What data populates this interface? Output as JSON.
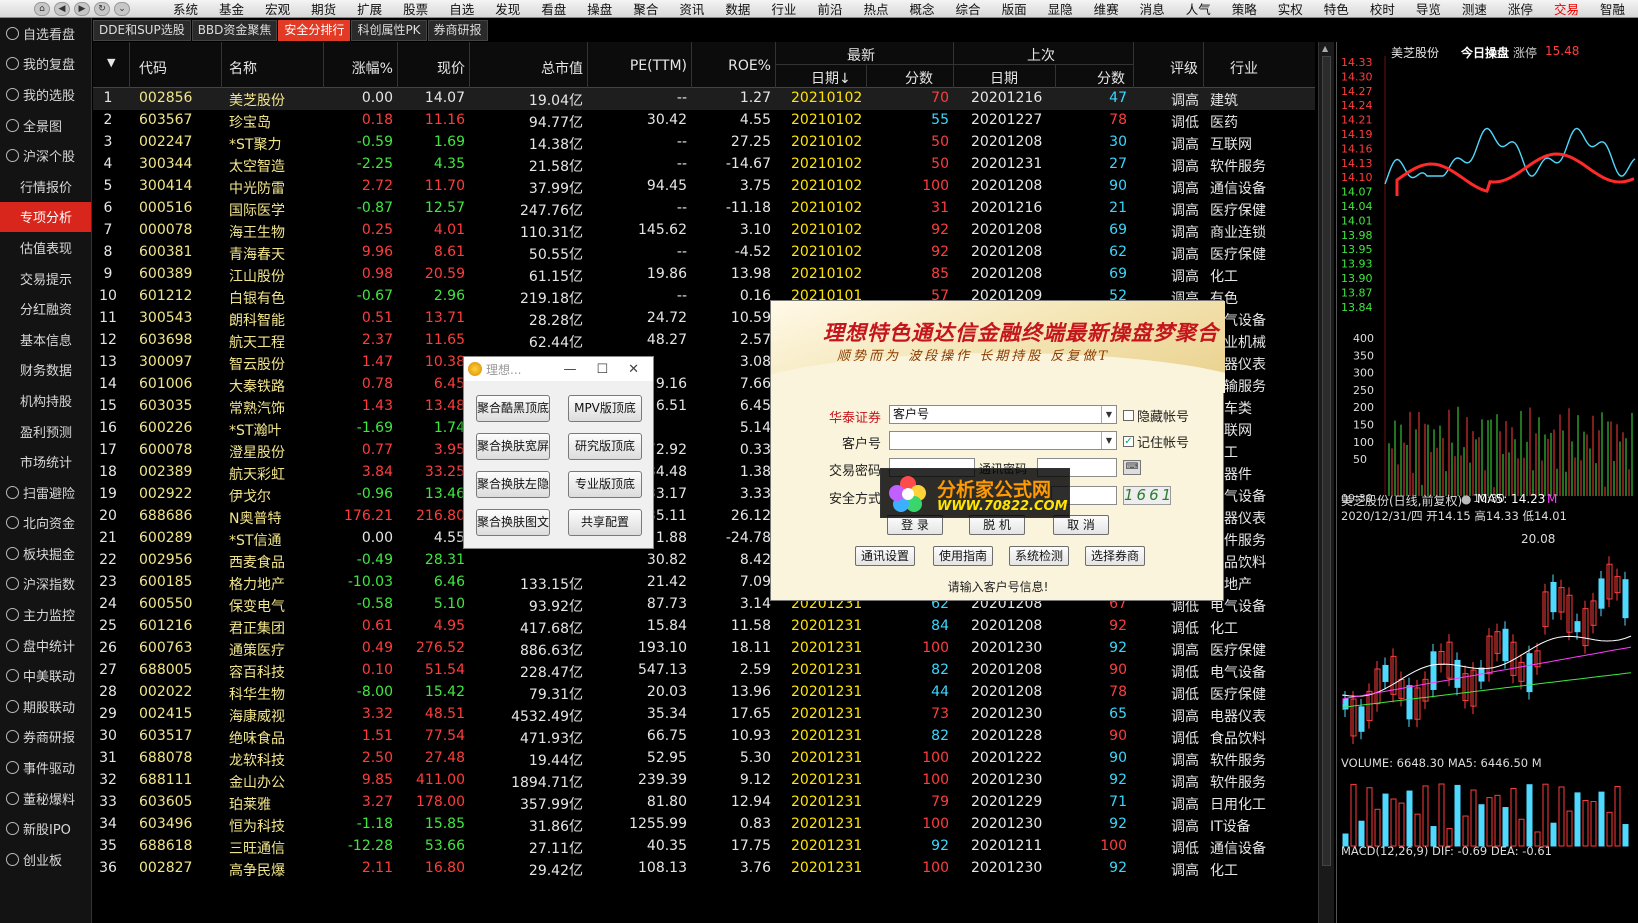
{
  "menu": [
    "系统",
    "基金",
    "宏观",
    "期货",
    "扩展",
    "股票",
    "自选",
    "发现",
    "看盘",
    "操盘",
    "聚合",
    "资讯",
    "数据",
    "行业",
    "前沿",
    "热点",
    "概念",
    "综合",
    "版面",
    "显隐",
    "维赛",
    "消息",
    "人气",
    "策略",
    "实权",
    "特色",
    "校时",
    "导览",
    "测速",
    "涨停",
    "交易",
    "智融"
  ],
  "menu_red_index": 30,
  "sidebar": [
    {
      "label": "自选看盘",
      "icon": "circle-icon"
    },
    {
      "label": "我的复盘",
      "icon": "heart-icon"
    },
    {
      "label": "我的选股",
      "icon": "circle-icon"
    },
    {
      "label": "全景图",
      "icon": "panorama-icon"
    },
    {
      "label": "沪深个股",
      "icon": "circle-icon"
    },
    {
      "label": "行情报价",
      "sub": true
    },
    {
      "label": "专项分析",
      "sub": true,
      "active": true
    },
    {
      "label": "估值表现",
      "sub": true
    },
    {
      "label": "交易提示",
      "sub": true
    },
    {
      "label": "分红融资",
      "sub": true
    },
    {
      "label": "基本信息",
      "sub": true
    },
    {
      "label": "财务数据",
      "sub": true
    },
    {
      "label": "机构持股",
      "sub": true
    },
    {
      "label": "盈利预测",
      "sub": true
    },
    {
      "label": "市场统计",
      "sub": true
    },
    {
      "label": "扫雷避险",
      "icon": "circle-icon"
    },
    {
      "label": "北向资金",
      "icon": "circle-icon"
    },
    {
      "label": "板块掘金",
      "icon": "star-icon"
    },
    {
      "label": "沪深指数",
      "icon": "circle-icon"
    },
    {
      "label": "主力监控",
      "icon": "circle-icon"
    },
    {
      "label": "盘中统计",
      "icon": "circle-icon"
    },
    {
      "label": "中美联动",
      "icon": "circle-icon"
    },
    {
      "label": "期股联动",
      "icon": "circle-icon"
    },
    {
      "label": "券商研报",
      "icon": "circle-icon"
    },
    {
      "label": "事件驱动",
      "icon": "circle-icon"
    },
    {
      "label": "董秘爆料",
      "icon": "circle-icon"
    },
    {
      "label": "新股IPO",
      "icon": "circle-icon"
    },
    {
      "label": "创业板",
      "icon": "circle-icon"
    }
  ],
  "subtabs": [
    "DDE和SUP选股",
    "BBD资金聚焦",
    "安全分排行",
    "科创属性PK",
    "券商研报"
  ],
  "subtab_active": 2,
  "headers": {
    "code": "代码",
    "name": "名称",
    "chg": "涨幅%",
    "price": "现价",
    "mcap": "总市值",
    "pe": "PE(TTM)",
    "roe": "ROE%",
    "latest": "最新",
    "prev": "上次",
    "date": "日期",
    "date_sorted": "日期↓",
    "score": "分数",
    "rating": "评级",
    "industry": "行业"
  },
  "rows": [
    [
      "1",
      "002856",
      "美芝股份",
      "0.00",
      "14.07",
      "19.04亿",
      "--",
      "1.27",
      "20210102",
      "70",
      "20201216",
      "47",
      "调高",
      "建筑"
    ],
    [
      "2",
      "603567",
      "珍宝岛",
      "0.18",
      "11.16",
      "94.77亿",
      "30.42",
      "4.55",
      "20210102",
      "55",
      "20201227",
      "78",
      "调低",
      "医药"
    ],
    [
      "3",
      "002247",
      "*ST聚力",
      "-0.59",
      "1.69",
      "14.38亿",
      "--",
      "27.25",
      "20210102",
      "50",
      "20201208",
      "30",
      "调高",
      "互联网"
    ],
    [
      "4",
      "300344",
      "太空智造",
      "-2.25",
      "4.35",
      "21.58亿",
      "--",
      "-14.67",
      "20210102",
      "50",
      "20201231",
      "27",
      "调高",
      "软件服务"
    ],
    [
      "5",
      "300414",
      "中光防雷",
      "2.72",
      "11.70",
      "37.99亿",
      "94.45",
      "3.75",
      "20210102",
      "100",
      "20201208",
      "90",
      "调高",
      "通信设备"
    ],
    [
      "6",
      "000516",
      "国际医学",
      "-0.87",
      "12.57",
      "247.76亿",
      "--",
      "-11.18",
      "20210102",
      "31",
      "20201216",
      "21",
      "调高",
      "医疗保健"
    ],
    [
      "7",
      "000078",
      "海王生物",
      "0.25",
      "4.01",
      "110.31亿",
      "145.62",
      "3.10",
      "20210102",
      "92",
      "20201208",
      "69",
      "调高",
      "商业连锁"
    ],
    [
      "8",
      "600381",
      "青海春天",
      "9.96",
      "8.61",
      "50.55亿",
      "--",
      "-4.52",
      "20210102",
      "92",
      "20201208",
      "62",
      "调高",
      "医疗保健"
    ],
    [
      "9",
      "600389",
      "江山股份",
      "0.98",
      "20.59",
      "61.15亿",
      "19.86",
      "13.98",
      "20210102",
      "85",
      "20201208",
      "69",
      "调高",
      "化工"
    ],
    [
      "10",
      "601212",
      "白银有色",
      "-0.67",
      "2.96",
      "219.18亿",
      "--",
      "0.16",
      "20210101",
      "57",
      "20201209",
      "52",
      "调高",
      "有色"
    ],
    [
      "11",
      "300543",
      "朗科智能",
      "0.51",
      "13.71",
      "28.28亿",
      "24.72",
      "10.59",
      "",
      "",
      "",
      "",
      "",
      "电气设备"
    ],
    [
      "12",
      "603698",
      "航天工程",
      "2.37",
      "11.65",
      "62.44亿",
      "48.27",
      "2.57",
      "",
      "",
      "",
      "",
      "",
      "工业机械"
    ],
    [
      "13",
      "300097",
      "智云股份",
      "1.47",
      "10.38",
      "",
      "",
      "3.08",
      "",
      "",
      "",
      "",
      "",
      "仪器仪表"
    ],
    [
      "14",
      "601006",
      "大秦铁路",
      "0.78",
      "6.45",
      "",
      "9.16",
      "7.66",
      "",
      "",
      "",
      "",
      "",
      "运输服务"
    ],
    [
      "15",
      "603035",
      "常熟汽饰",
      "1.43",
      "13.48",
      "",
      "6.51",
      "6.45",
      "",
      "",
      "",
      "",
      "",
      "汽车类"
    ],
    [
      "16",
      "600226",
      "*ST瀚叶",
      "-1.69",
      "1.74",
      "",
      "",
      "5.14",
      "",
      "",
      "",
      "",
      "",
      "互联网"
    ],
    [
      "17",
      "600078",
      "澄星股份",
      "0.77",
      "3.95",
      "",
      "72.92",
      "0.33",
      "",
      "",
      "",
      "",
      "",
      "化工"
    ],
    [
      "18",
      "002389",
      "航天彩虹",
      "3.84",
      "33.25",
      "",
      "34.48",
      "1.38",
      "",
      "",
      "",
      "",
      "",
      "元器件"
    ],
    [
      "19",
      "002922",
      "伊戈尔",
      "-0.96",
      "13.46",
      "",
      "33.17",
      "3.33",
      "",
      "",
      "",
      "",
      "",
      "电气设备"
    ],
    [
      "20",
      "688686",
      "N奥普特",
      "176.21",
      "216.80",
      "",
      "35.11",
      "26.12",
      "",
      "",
      "",
      "",
      "",
      "仪器仪表"
    ],
    [
      "21",
      "600289",
      "*ST信通",
      "0.00",
      "4.55",
      "",
      "1.88",
      "-24.78",
      "",
      "",
      "",
      "",
      "",
      "软件服务"
    ],
    [
      "22",
      "002956",
      "西麦食品",
      "-0.49",
      "28.31",
      "",
      "30.82",
      "8.42",
      "",
      "",
      "",
      "",
      "",
      "食品饮料"
    ],
    [
      "23",
      "600185",
      "格力地产",
      "-10.03",
      "6.46",
      "133.15亿",
      "21.42",
      "7.09",
      "",
      "",
      "",
      "",
      "",
      "房地产"
    ],
    [
      "24",
      "600550",
      "保变电气",
      "-0.58",
      "5.10",
      "93.92亿",
      "87.73",
      "3.14",
      "20201231",
      "62",
      "20201208",
      "67",
      "调低",
      "电气设备"
    ],
    [
      "25",
      "601216",
      "君正集团",
      "0.61",
      "4.95",
      "417.68亿",
      "15.84",
      "11.58",
      "20201231",
      "84",
      "20201208",
      "92",
      "调低",
      "化工"
    ],
    [
      "26",
      "600763",
      "通策医疗",
      "0.49",
      "276.52",
      "886.63亿",
      "193.10",
      "18.11",
      "20201231",
      "100",
      "20201230",
      "92",
      "调高",
      "医疗保健"
    ],
    [
      "27",
      "688005",
      "容百科技",
      "0.10",
      "51.54",
      "228.47亿",
      "547.13",
      "2.59",
      "20201231",
      "82",
      "20201208",
      "90",
      "调低",
      "电气设备"
    ],
    [
      "28",
      "002022",
      "科华生物",
      "-8.00",
      "15.42",
      "79.31亿",
      "20.03",
      "13.96",
      "20201231",
      "44",
      "20201208",
      "78",
      "调低",
      "医疗保健"
    ],
    [
      "29",
      "002415",
      "海康威视",
      "3.32",
      "48.51",
      "4532.49亿",
      "35.34",
      "17.65",
      "20201231",
      "73",
      "20201230",
      "65",
      "调高",
      "电器仪表"
    ],
    [
      "30",
      "603517",
      "绝味食品",
      "1.51",
      "77.54",
      "471.93亿",
      "66.75",
      "10.93",
      "20201231",
      "82",
      "20201228",
      "90",
      "调低",
      "食品饮料"
    ],
    [
      "31",
      "688078",
      "龙软科技",
      "2.50",
      "27.48",
      "19.44亿",
      "52.95",
      "5.30",
      "20201231",
      "100",
      "20201222",
      "90",
      "调高",
      "软件服务"
    ],
    [
      "32",
      "688111",
      "金山办公",
      "9.85",
      "411.00",
      "1894.71亿",
      "239.39",
      "9.12",
      "20201231",
      "100",
      "20201230",
      "92",
      "调高",
      "软件服务"
    ],
    [
      "33",
      "603605",
      "珀莱雅",
      "3.27",
      "178.00",
      "357.99亿",
      "81.80",
      "12.94",
      "20201231",
      "79",
      "20201229",
      "71",
      "调高",
      "日用化工"
    ],
    [
      "34",
      "603496",
      "恒为科技",
      "-1.18",
      "15.85",
      "31.86亿",
      "1255.99",
      "0.83",
      "20201231",
      "100",
      "20201230",
      "92",
      "调高",
      "IT设备"
    ],
    [
      "35",
      "688618",
      "三旺通信",
      "-12.28",
      "53.66",
      "27.11亿",
      "40.35",
      "17.75",
      "20201231",
      "92",
      "20201211",
      "100",
      "调低",
      "通信设备"
    ],
    [
      "36",
      "002827",
      "高争民爆",
      "2.11",
      "16.80",
      "29.42亿",
      "108.13",
      "3.76",
      "20201231",
      "100",
      "20201230",
      "92",
      "调高",
      "化工"
    ]
  ],
  "right": {
    "stock": "美芝股份",
    "tab": "今日操盘",
    "zt_label": "涨停",
    "zt_value": "15.48",
    "price_ticks": [
      "14.33",
      "14.30",
      "14.27",
      "14.24",
      "14.21",
      "14.19",
      "14.16",
      "14.13",
      "14.10",
      "14.07",
      "14.04",
      "14.01",
      "13.98",
      "13.95",
      "13.93",
      "13.90",
      "13.87",
      "13.84"
    ],
    "vol_ticks": [
      "400",
      "350",
      "300",
      "250",
      "200",
      "150",
      "100",
      "50"
    ],
    "times": [
      "09:30",
      "10:30"
    ],
    "kline_title": "美芝股份(日线,前复权)",
    "ma5": "MA5: 14.23",
    "ma_extra": "M",
    "kline_info": "2020/12/31/四  开14.15  高14.33  低14.01",
    "high_label": "20.08",
    "volume_line": "VOLUME: 6648.30  MA5: 6446.50  M",
    "macd_line": "MACD(12,26,9)  DIF: -0.69  DEA: -0.61"
  },
  "skin_dialog": {
    "title": "理想...",
    "buttons": [
      "聚合酷黑顶底",
      "MPV版顶底",
      "聚合换肤宽屏",
      "研究版顶底",
      "聚合换肤左隐",
      "专业版顶底",
      "聚合换肤图文",
      "共享配置"
    ]
  },
  "login": {
    "banner_title": "理想特色通达信金融终端最新操盘梦聚合",
    "banner_sub": "顺势而为  波段操作  长期持股  反复做T",
    "broker_label": "华泰证券",
    "broker_value": "客户号",
    "account_label": "客户号",
    "account_value": "",
    "pwd_label": "交易密码",
    "comm_pwd_label": "通讯密码",
    "safety_label": "安全方式",
    "captcha": "1661",
    "hide_account": "隐藏帐号",
    "remember_account": "记住帐号",
    "btn_login": "登 录",
    "btn_offline": "脱 机",
    "btn_cancel": "取 消",
    "btn_comm": "通讯设置",
    "btn_guide": "使用指南",
    "btn_check": "系统检测",
    "btn_broker": "选择券商",
    "status": "请输入客户号信息!"
  },
  "watermark": {
    "line1": "分析家公式网",
    "line2": "WWW.70822.COM"
  }
}
